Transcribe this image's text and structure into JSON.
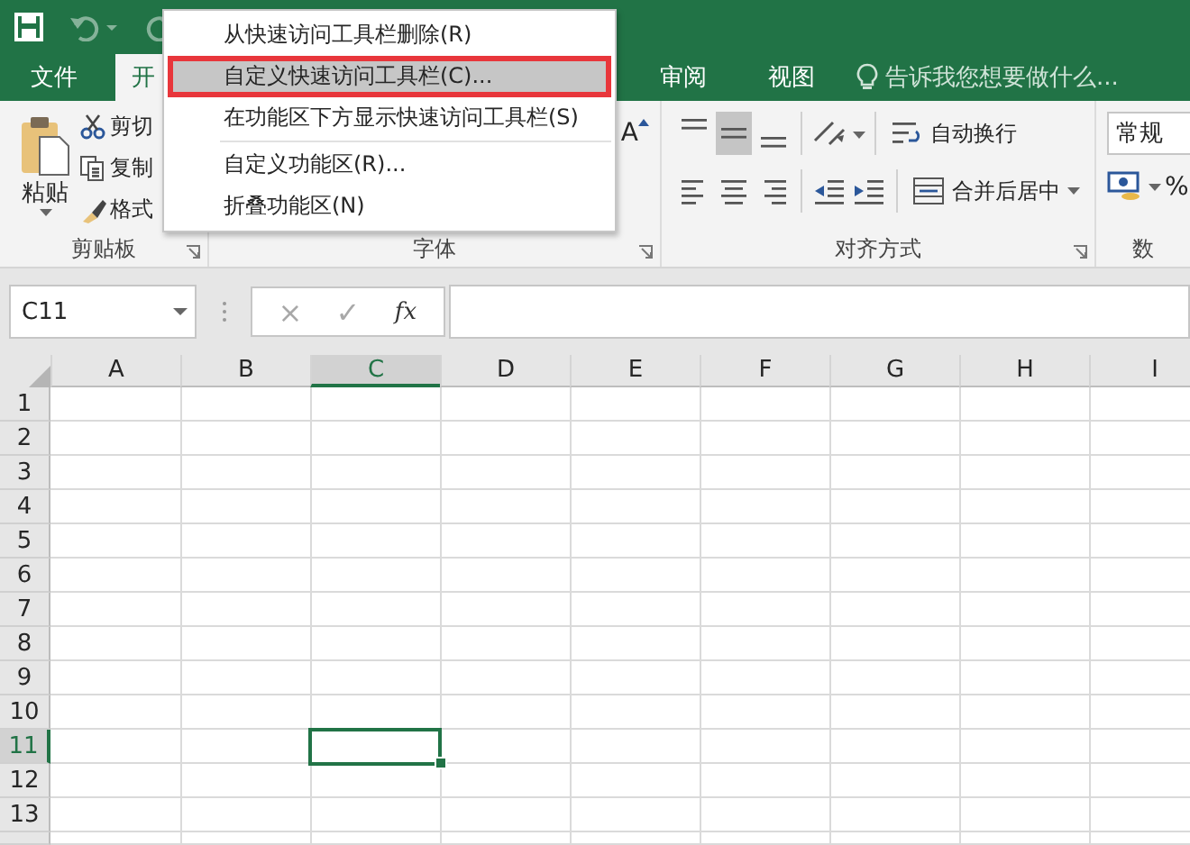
{
  "title_bar": {
    "quick_access": [
      {
        "kind": "save",
        "disabled": false
      },
      {
        "kind": "undo",
        "disabled": true
      },
      {
        "kind": "redo",
        "disabled": true
      }
    ]
  },
  "tabs": [
    {
      "label": "文件",
      "selected": false
    },
    {
      "label": "开",
      "selected": true
    },
    {
      "label": "审阅",
      "selected": false
    },
    {
      "label": "视图",
      "selected": false
    }
  ],
  "tell_me": {
    "placeholder": "告诉我您想要做什么..."
  },
  "ribbon": {
    "groups": [
      {
        "kind": "clipboard",
        "label": "剪贴板",
        "paste": "粘贴",
        "buttons": [
          {
            "kind": "cut",
            "label": "剪切"
          },
          {
            "kind": "copy",
            "label": "复制"
          },
          {
            "kind": "painter",
            "label": "格式"
          }
        ]
      },
      {
        "kind": "font",
        "label": "字体",
        "grow": "A"
      },
      {
        "kind": "alignment",
        "label": "对齐方式",
        "vertical": [
          {
            "kind": "top",
            "selected": false
          },
          {
            "kind": "middle",
            "selected": true
          },
          {
            "kind": "bottom",
            "selected": false
          }
        ],
        "wrap": "自动换行",
        "merge": "合并后居中"
      },
      {
        "kind": "number",
        "label": "数",
        "format": "常规",
        "percent": "%"
      }
    ]
  },
  "formula_bar": {
    "name_box": "C11",
    "cancel": "×",
    "enter": "✓",
    "function": "fx"
  },
  "sheet": {
    "columns": [
      {
        "label": "A",
        "selected": false
      },
      {
        "label": "B",
        "selected": false
      },
      {
        "label": "C",
        "selected": true
      },
      {
        "label": "D",
        "selected": false
      },
      {
        "label": "E",
        "selected": false
      },
      {
        "label": "F",
        "selected": false
      },
      {
        "label": "G",
        "selected": false
      },
      {
        "label": "H",
        "selected": false
      },
      {
        "label": "I",
        "selected": false
      }
    ],
    "rows": [
      {
        "label": "1",
        "selected": false
      },
      {
        "label": "2",
        "selected": false
      },
      {
        "label": "3",
        "selected": false
      },
      {
        "label": "4",
        "selected": false
      },
      {
        "label": "5",
        "selected": false
      },
      {
        "label": "6",
        "selected": false
      },
      {
        "label": "7",
        "selected": false
      },
      {
        "label": "8",
        "selected": false
      },
      {
        "label": "9",
        "selected": false
      },
      {
        "label": "10",
        "selected": false
      },
      {
        "label": "11",
        "selected": true
      },
      {
        "label": "12",
        "selected": false
      },
      {
        "label": "13",
        "selected": false
      }
    ]
  },
  "context_menu": {
    "items": [
      {
        "label": "从快速访问工具栏删除(R)",
        "selected": false,
        "separator_before": false
      },
      {
        "label": "自定义快速访问工具栏(C)...",
        "selected": true,
        "separator_before": false
      },
      {
        "label": "在功能区下方显示快速访问工具栏(S)",
        "selected": false,
        "separator_before": false
      },
      {
        "label": "自定义功能区(R)...",
        "selected": false,
        "separator_before": true
      },
      {
        "label": "折叠功能区(N)",
        "selected": false,
        "separator_before": false
      }
    ]
  }
}
